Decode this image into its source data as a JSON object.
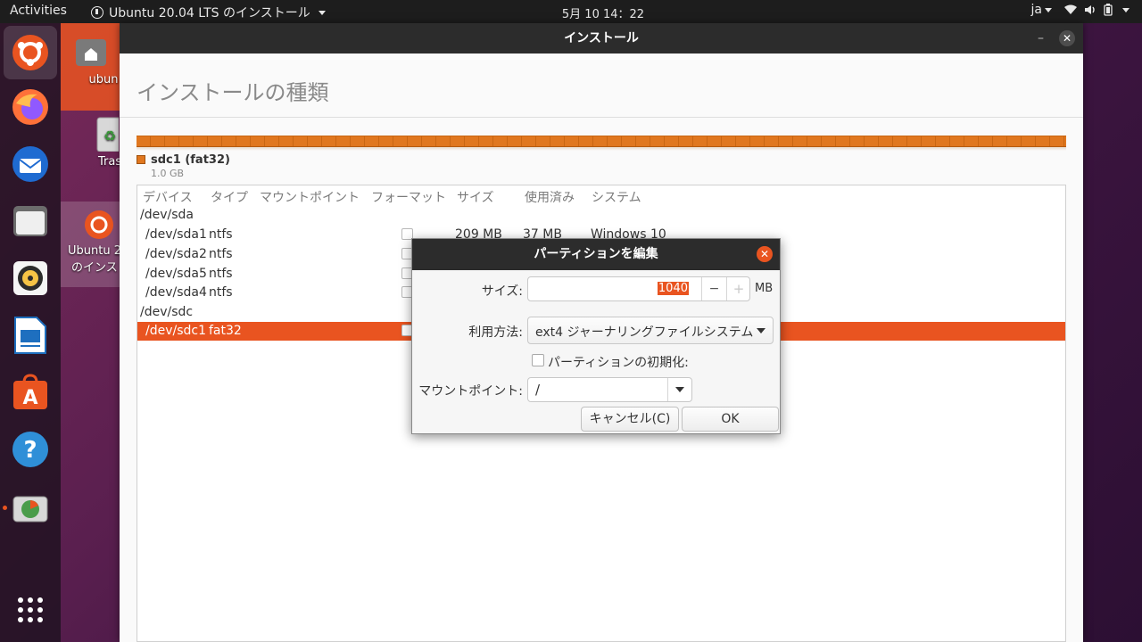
{
  "topbar": {
    "activities": "Activities",
    "app_menu": "Ubuntu 20.04 LTS のインストール",
    "clock": "5月 10  14：22",
    "lang": "ja"
  },
  "desktop": {
    "home_label": "ubun",
    "trash_label": "Tras",
    "installer_label_1": "Ubuntu 2",
    "installer_label_2": "のインス"
  },
  "window": {
    "title": "インストール",
    "minimize": "–",
    "close": "✕",
    "heading": "インストールの種類"
  },
  "partition_bar": {
    "legend_label": "sdc1 (fat32)",
    "legend_size": "1.0 GB",
    "color": "#e0771f"
  },
  "table": {
    "headers": [
      "デバイス",
      "タイプ",
      "マウントポイント",
      "フォーマット",
      "サイズ",
      "使用済み",
      "システム"
    ],
    "rows": [
      {
        "device": "/dev/sda",
        "type": "",
        "size": "",
        "used": "",
        "system": ""
      },
      {
        "device": "/dev/sda1",
        "type": "ntfs",
        "size": "209 MB",
        "used": "37 MB",
        "system": "Windows 10"
      },
      {
        "device": "/dev/sda2",
        "type": "ntfs",
        "size": "",
        "used": "",
        "system": ""
      },
      {
        "device": "/dev/sda5",
        "type": "ntfs",
        "size": "",
        "used": "",
        "system": ""
      },
      {
        "device": "/dev/sda4",
        "type": "ntfs",
        "size": "",
        "used": "",
        "system": ""
      },
      {
        "device": "/dev/sdc",
        "type": "",
        "size": "",
        "used": "",
        "system": ""
      },
      {
        "device": "/dev/sdc1",
        "type": "fat32",
        "size": "",
        "used": "",
        "system": ""
      }
    ]
  },
  "dialog": {
    "title": "パーティションを編集",
    "close": "✕",
    "size_label": "サイズ:",
    "size_value": "1040",
    "size_minus": "−",
    "size_plus": "+",
    "size_unit": "MB",
    "use_label": "利用方法:",
    "use_value": "ext4 ジャーナリングファイルシステム",
    "format_label": "パーティションの初期化:",
    "mount_label": "マウントポイント:",
    "mount_value": "/",
    "cancel": "キャンセル(C)",
    "ok": "OK"
  },
  "colors": {
    "accent": "#e95420",
    "topbar": "#1d1d1d",
    "titlebar": "#2c2c2c"
  }
}
